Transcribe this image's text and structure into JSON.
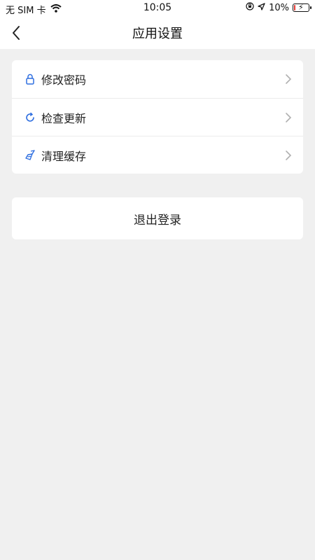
{
  "status_bar": {
    "carrier": "无 SIM 卡",
    "time": "10:05",
    "battery": "10%",
    "battery_level": 0.1,
    "battery_color": "#e53935"
  },
  "nav": {
    "back_icon": "chevron-left-icon",
    "title": "应用设置"
  },
  "settings": {
    "items": [
      {
        "label": "修改密码",
        "icon": "lock-icon"
      },
      {
        "label": "检查更新",
        "icon": "refresh-icon"
      },
      {
        "label": "清理缓存",
        "icon": "broom-icon"
      }
    ]
  },
  "logout": {
    "label": "退出登录"
  },
  "colors": {
    "accent": "#2f6fe0",
    "background": "#f0f0f0"
  }
}
